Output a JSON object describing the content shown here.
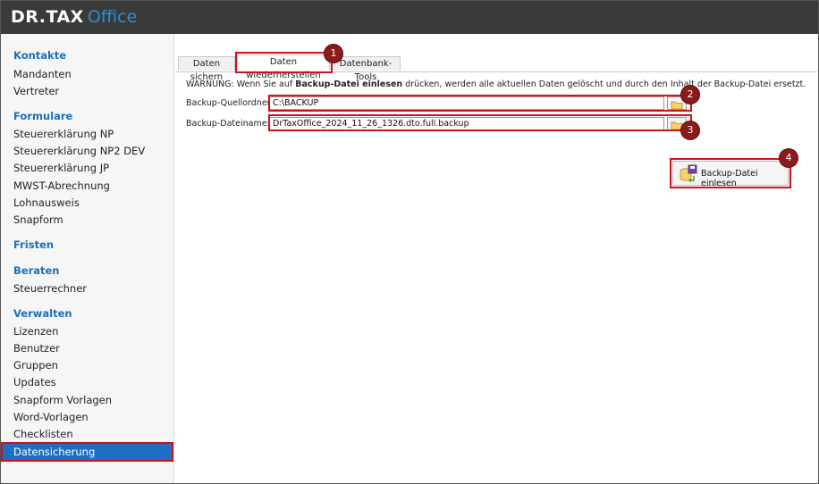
{
  "header": {
    "brand": "DR.TAX",
    "product": "Office"
  },
  "sidebar": {
    "sections": [
      {
        "title": "Kontakte",
        "items": [
          "Mandanten",
          "Vertreter"
        ]
      },
      {
        "title": "Formulare",
        "items": [
          "Steuererklärung NP",
          "Steuererklärung NP2 DEV",
          "Steuererklärung JP",
          "MWST-Abrechnung",
          "Lohnausweis",
          "Snapform"
        ]
      },
      {
        "title": "Fristen",
        "items": []
      },
      {
        "title": "Beraten",
        "items": [
          "Steuerrechner"
        ]
      },
      {
        "title": "Verwalten",
        "items": [
          "Lizenzen",
          "Benutzer",
          "Gruppen",
          "Updates",
          "Snapform Vorlagen",
          "Word-Vorlagen",
          "Checklisten"
        ]
      }
    ],
    "active_item": "Datensicherung"
  },
  "tabs": [
    "Daten sichern",
    "Daten wiederherstellen",
    "Datenbank-Tools"
  ],
  "warning": {
    "prefix": "WARNUNG: Wenn Sie auf ",
    "bold": "Backup-Datei einlesen",
    "suffix": " drücken, werden alle aktuellen Daten gelöscht und durch den Inhalt der Backup-Datei ersetzt."
  },
  "fields": {
    "source_folder_label": "Backup-Quellordner:",
    "source_folder_value": "C:\\BACKUP",
    "file_name_label": "Backup-Dateiname:",
    "file_name_value": "DrTaxOffice_2024_11_26_1326.dto.full.backup"
  },
  "read_button_label": "Backup-Datei einlesen",
  "markers": [
    "1",
    "2",
    "3",
    "4"
  ],
  "colors": {
    "accent": "#1a6fbf",
    "highlight": "#d0121a",
    "marker": "#8b1a1a",
    "header": "#3a3a3a"
  }
}
